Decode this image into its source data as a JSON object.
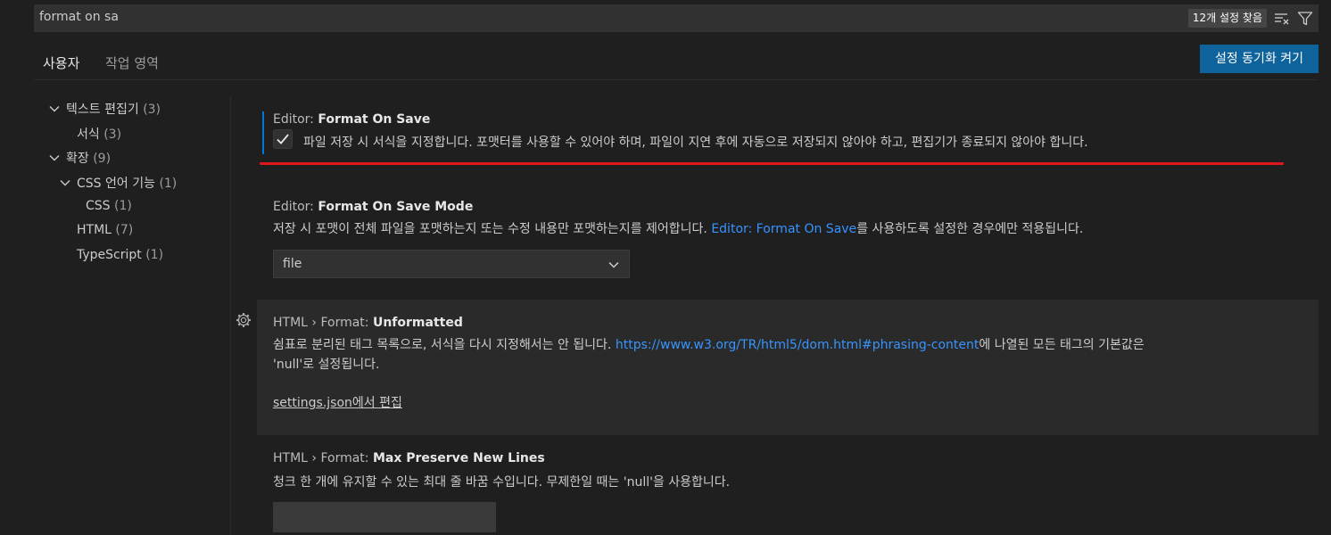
{
  "search": {
    "value": "format on sa",
    "result_count": "12개 설정 찾음",
    "clear_filter_icon": "clear-filter-icon",
    "filter_icon": "filter-icon"
  },
  "tabs": [
    {
      "label": "사용자",
      "active": true
    },
    {
      "label": "작업 영역",
      "active": false
    }
  ],
  "sync_button": "설정 동기화 켜기",
  "tree": [
    {
      "label": "텍스트 편집기",
      "count": "(3)",
      "expanded": true
    },
    {
      "label": "서식",
      "count": "(3)"
    },
    {
      "label": "확장",
      "count": "(9)",
      "expanded": true
    },
    {
      "label": "CSS 언어 기능",
      "count": "(1)",
      "expanded": true
    },
    {
      "label": "CSS",
      "count": "(1)"
    },
    {
      "label": "HTML",
      "count": "(7)"
    },
    {
      "label": "TypeScript",
      "count": "(1)"
    }
  ],
  "settings": {
    "format_on_save": {
      "category": "Editor: ",
      "name": "Format On Save",
      "checked": true,
      "description": "파일 저장 시 서식을 지정합니다. 포맷터를 사용할 수 있어야 하며, 파일이 지연 후에 자동으로 저장되지 않아야 하고, 편집기가 종료되지 않아야 합니다."
    },
    "format_on_save_mode": {
      "category": "Editor: ",
      "name": "Format On Save Mode",
      "desc_before": "저장 시 포맷이 전체 파일을 포맷하는지 또는 수정 내용만 포맷하는지를 제어합니다. ",
      "desc_link": "Editor: Format On Save",
      "desc_after": "를 사용하도록 설정한 경우에만 적용됩니다.",
      "value": "file"
    },
    "html_unformatted": {
      "category": "HTML › Format: ",
      "name": "Unformatted",
      "desc_before": "쉼표로 분리된 태그 목록으로, 서식을 다시 지정해서는 안 됩니다. ",
      "desc_link": "https://www.w3.org/TR/html5/dom.html#phrasing-content",
      "desc_after": "에 나열된 모든 태그의 기본값은",
      "desc_line2": "'null'로 설정됩니다.",
      "edit_link": "settings.json에서 편집"
    },
    "html_max_preserve": {
      "category": "HTML › Format: ",
      "name": "Max Preserve New Lines",
      "description": "청크 한 개에 유지할 수 있는 최대 줄 바꿈 수입니다. 무제한일 때는 'null'을 사용합니다.",
      "value": ""
    }
  },
  "colors": {
    "accent": "#0e639c",
    "link": "#3794ff",
    "modified_indicator": "#0078d4",
    "annotation_red": "#e0181b"
  }
}
